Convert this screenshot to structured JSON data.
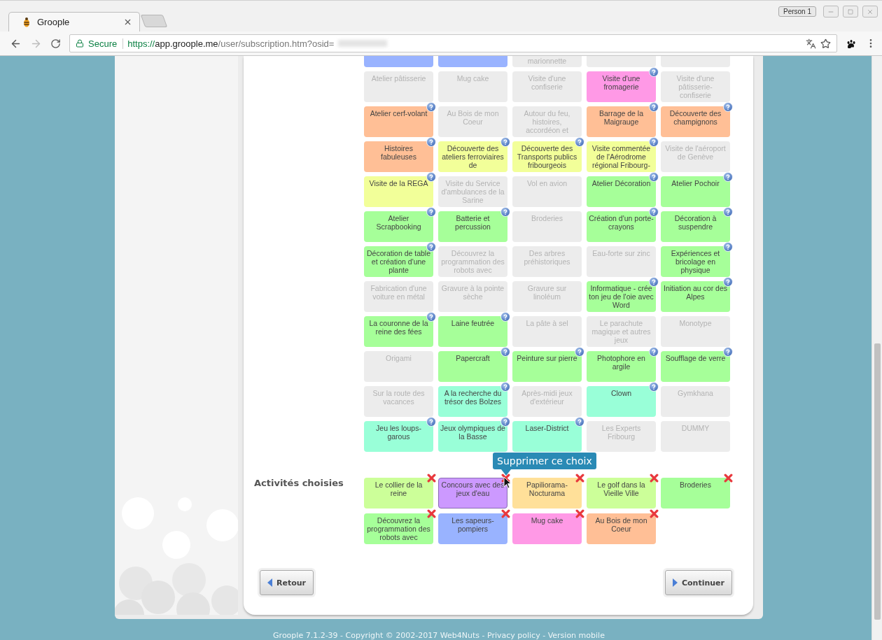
{
  "browser": {
    "tab_title": "Groople",
    "profile": "Person 1",
    "secure_label": "Secure",
    "url": {
      "scheme": "https://",
      "host": "app.groople.me",
      "path": "/user/subscription.htm?osid="
    }
  },
  "activities_partial": [
    {
      "color": "#99b3ff"
    },
    {
      "color": "#99b3ff"
    },
    {
      "label": "marionnette",
      "color": "#ececec"
    },
    {
      "color": "#ececec"
    },
    {
      "color": "#ececec"
    }
  ],
  "activities": [
    {
      "label": "Atelier pâtisserie",
      "available": false,
      "color": "#ececec"
    },
    {
      "label": "Mug cake",
      "available": false,
      "color": "#ececec"
    },
    {
      "label": "Visite d'une confiserie",
      "available": false,
      "color": "#ececec"
    },
    {
      "label": "Visite d'une fromagerie",
      "available": true,
      "color": "#ff99e6"
    },
    {
      "label": "Visite d'une pâtisserie-confiserie",
      "available": false,
      "color": "#ececec"
    },
    {
      "label": "Atelier cerf-volant",
      "available": true,
      "color": "#ffbf96"
    },
    {
      "label": "Au Bois de mon Coeur",
      "available": false,
      "color": "#ececec"
    },
    {
      "label": "Autour du feu, histoires, accordéon et",
      "available": false,
      "color": "#ececec"
    },
    {
      "label": "Barrage de la Maigrauge",
      "available": true,
      "color": "#ffbf96"
    },
    {
      "label": "Découverte des champignons",
      "available": true,
      "color": "#ffbf96"
    },
    {
      "label": "Histoires fabuleuses",
      "available": true,
      "color": "#ffbf96"
    },
    {
      "label": "Découverte des ateliers ferroviaires de",
      "available": true,
      "color": "#f2ff99"
    },
    {
      "label": "Découverte des Transports publics fribourgeois",
      "available": true,
      "color": "#f2ff99"
    },
    {
      "label": "Visite commentée de l'Aérodrome régional Fribourg-",
      "available": true,
      "color": "#f2ff99"
    },
    {
      "label": "Visite de l'aéroport de Genève",
      "available": false,
      "color": "#ececec"
    },
    {
      "label": "Visite de la REGA",
      "available": true,
      "color": "#f2ff99"
    },
    {
      "label": "Visite du Service d'ambulances de la Sarine",
      "available": false,
      "color": "#ececec"
    },
    {
      "label": "Vol en avion",
      "available": false,
      "color": "#ececec"
    },
    {
      "label": "Atelier Décoration",
      "available": true,
      "color": "#a6ff99"
    },
    {
      "label": "Atelier Pochoir",
      "available": true,
      "color": "#a6ff99"
    },
    {
      "label": "Atelier Scrapbooking",
      "available": true,
      "color": "#a6ff99"
    },
    {
      "label": "Batterie et percussion",
      "available": true,
      "color": "#a6ff99"
    },
    {
      "label": "Broderies",
      "available": false,
      "color": "#ececec"
    },
    {
      "label": "Création d'un porte-crayons",
      "available": true,
      "color": "#a6ff99"
    },
    {
      "label": "Décoration à suspendre",
      "available": true,
      "color": "#a6ff99"
    },
    {
      "label": "Décoration de table et création d'une plante",
      "available": true,
      "color": "#a6ff99"
    },
    {
      "label": "Découvrez la programmation des robots avec",
      "available": false,
      "color": "#ececec"
    },
    {
      "label": "Des arbres préhistoriques",
      "available": false,
      "color": "#ececec"
    },
    {
      "label": "Eau-forte sur zinc",
      "available": false,
      "color": "#ececec"
    },
    {
      "label": "Expériences et bricolage en physique",
      "available": true,
      "color": "#a6ff99"
    },
    {
      "label": "Fabrication d'une voiture en métal",
      "available": false,
      "color": "#ececec"
    },
    {
      "label": "Gravure à la pointe sèche",
      "available": false,
      "color": "#ececec"
    },
    {
      "label": "Gravure sur linoléum",
      "available": false,
      "color": "#ececec"
    },
    {
      "label": "Informatique - crée ton jeu de l'oie avec Word",
      "available": true,
      "color": "#a6ff99"
    },
    {
      "label": "Initiation au cor des Alpes",
      "available": true,
      "color": "#a6ff99"
    },
    {
      "label": "La couronne de la reine des fées",
      "available": true,
      "color": "#a6ff99"
    },
    {
      "label": "Laine feutrée",
      "available": true,
      "color": "#a6ff99"
    },
    {
      "label": "La pâte à sel",
      "available": false,
      "color": "#ececec"
    },
    {
      "label": "Le parachute magique et autres jeux",
      "available": false,
      "color": "#ececec"
    },
    {
      "label": "Monotype",
      "available": false,
      "color": "#ececec"
    },
    {
      "label": "Origami",
      "available": false,
      "color": "#ececec"
    },
    {
      "label": "Papercraft",
      "available": true,
      "color": "#a6ff99"
    },
    {
      "label": "Peinture sur pierre",
      "available": true,
      "color": "#a6ff99"
    },
    {
      "label": "Photophore en argile",
      "available": true,
      "color": "#a6ff99"
    },
    {
      "label": "Soufflage de verre",
      "available": true,
      "color": "#a6ff99"
    },
    {
      "label": "Sur la route des vacances",
      "available": false,
      "color": "#ececec"
    },
    {
      "label": "A la recherche du trésor des Bolzes",
      "available": true,
      "color": "#99ffd8"
    },
    {
      "label": "Après-midi jeux d'extérieur",
      "available": false,
      "color": "#ececec"
    },
    {
      "label": "Clown",
      "available": true,
      "color": "#99ffd8"
    },
    {
      "label": "Gymkhana",
      "available": false,
      "color": "#ececec"
    },
    {
      "label": "Jeu les loups-garous",
      "available": true,
      "color": "#99ffd8"
    },
    {
      "label": "Jeux olympiques de la Basse",
      "available": true,
      "color": "#99ffd8"
    },
    {
      "label": "Laser-District",
      "available": true,
      "color": "#99ffd8"
    },
    {
      "label": "Les Experts Fribourg",
      "available": false,
      "color": "#ececec"
    },
    {
      "label": "DUMMY",
      "available": false,
      "color": "#ececec"
    }
  ],
  "chosen": {
    "title": "Activités choisies",
    "tooltip": "Supprimer ce choix",
    "items": [
      {
        "label": "Le collier de la reine",
        "color": "#ccff99",
        "hovered": false
      },
      {
        "label": "Concours avec des jeux d'eau",
        "color": "#cc99ff",
        "hovered": true
      },
      {
        "label": "Papiliorama-Nocturama",
        "color": "#ffe099",
        "hovered": false
      },
      {
        "label": "Le golf dans la Vieille Ville",
        "color": "#ccff99",
        "hovered": false
      },
      {
        "label": "Broderies",
        "color": "#a6ff99",
        "hovered": false
      },
      {
        "label": "Découvrez la programmation des robots avec",
        "color": "#a6ff99",
        "hovered": false
      },
      {
        "label": "Les sapeurs-pompiers",
        "color": "#99b3ff",
        "hovered": false
      },
      {
        "label": "Mug cake",
        "color": "#ff99e6",
        "hovered": false
      },
      {
        "label": "Au Bois de mon Coeur",
        "color": "#ffbf96",
        "hovered": false
      }
    ]
  },
  "buttons": [
    {
      "label": "Retour",
      "kind": "back"
    },
    {
      "label": "Continuer",
      "kind": "next"
    }
  ],
  "footer": [
    {
      "kind": "text",
      "text": "Groople 7.1.2-39 - Copyright © 2002-2017 Web4Nuts - "
    },
    {
      "kind": "link",
      "text": "Privacy policy"
    },
    {
      "kind": "text",
      "text": " - "
    },
    {
      "kind": "link",
      "text": "Version mobile"
    }
  ]
}
